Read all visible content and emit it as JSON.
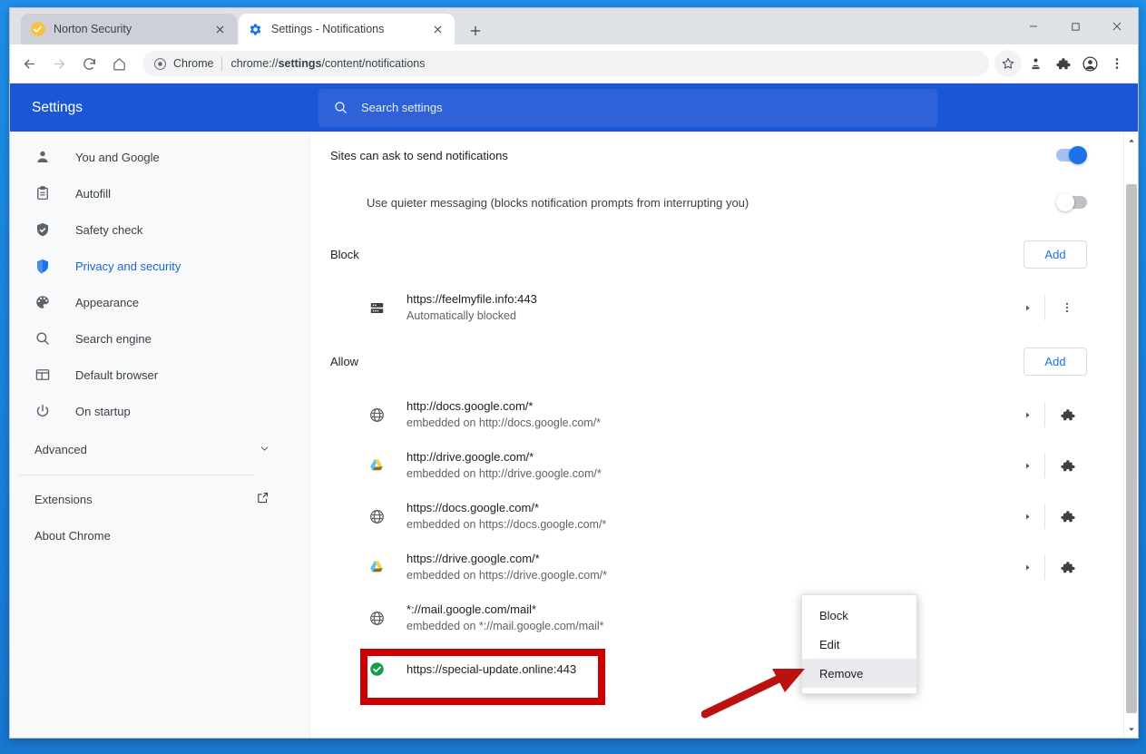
{
  "browser": {
    "tabs": [
      {
        "title": "Norton Security",
        "favicon": "norton-check-icon",
        "active": false
      },
      {
        "title": "Settings - Notifications",
        "favicon": "gear-icon",
        "active": true
      }
    ],
    "new_tab_label": "+",
    "window_controls": {
      "minimize": "—",
      "maximize": "☐",
      "close": "✕"
    },
    "omnibox": {
      "scheme_label": "Chrome",
      "url_prefix": "chrome://",
      "url_bold": "settings",
      "url_suffix": "/content/notifications",
      "full_url": "chrome://settings/content/notifications"
    },
    "toolbar_icons": [
      "back-icon",
      "forward-icon",
      "reload-icon",
      "home-icon",
      "bookmark-star-icon",
      "norton-extension-icon",
      "extensions-puzzle-icon",
      "profile-avatar-icon",
      "chrome-menu-icon"
    ]
  },
  "settings": {
    "title": "Settings",
    "search_placeholder": "Search settings",
    "sidebar": {
      "items": [
        {
          "label": "You and Google",
          "icon": "person-icon",
          "active": false
        },
        {
          "label": "Autofill",
          "icon": "clipboard-icon",
          "active": false
        },
        {
          "label": "Safety check",
          "icon": "shield-check-icon",
          "active": false
        },
        {
          "label": "Privacy and security",
          "icon": "shield-icon",
          "active": true
        },
        {
          "label": "Appearance",
          "icon": "palette-icon",
          "active": false
        },
        {
          "label": "Search engine",
          "icon": "search-icon",
          "active": false
        },
        {
          "label": "Default browser",
          "icon": "browser-window-icon",
          "active": false
        },
        {
          "label": "On startup",
          "icon": "power-icon",
          "active": false
        }
      ],
      "advanced_label": "Advanced",
      "extensions_label": "Extensions",
      "about_label": "About Chrome"
    },
    "main": {
      "primary_toggle": {
        "label": "Sites can ask to send notifications",
        "state": "on"
      },
      "quieter_toggle": {
        "label": "Use quieter messaging (blocks notification prompts from interrupting you)",
        "state": "off"
      },
      "block_section": {
        "title": "Block",
        "add_label": "Add",
        "rows": [
          {
            "url": "https://feelmyfile.info:443",
            "sub": "Automatically blocked",
            "icon": "server-rack-icon",
            "action": "overflow-menu-icon"
          }
        ]
      },
      "allow_section": {
        "title": "Allow",
        "add_label": "Add",
        "rows": [
          {
            "url": "http://docs.google.com/*",
            "sub": "embedded on http://docs.google.com/*",
            "icon": "globe-icon",
            "action": "extension-puzzle-icon"
          },
          {
            "url": "http://drive.google.com/*",
            "sub": "embedded on http://drive.google.com/*",
            "icon": "drive-favicon",
            "action": "extension-puzzle-icon"
          },
          {
            "url": "https://docs.google.com/*",
            "sub": "embedded on https://docs.google.com/*",
            "icon": "globe-icon",
            "action": "extension-puzzle-icon"
          },
          {
            "url": "https://drive.google.com/*",
            "sub": "embedded on https://drive.google.com/*",
            "icon": "drive-favicon",
            "action": "extension-puzzle-icon"
          },
          {
            "url": "*://mail.google.com/mail*",
            "sub": "embedded on *://mail.google.com/mail*",
            "icon": "globe-icon",
            "action": "extension-puzzle-icon"
          },
          {
            "url": "https://special-update.online:443",
            "sub": "",
            "icon": "green-check-icon",
            "action": "",
            "highlighted": true
          }
        ]
      }
    }
  },
  "context_menu": {
    "items": [
      {
        "label": "Block",
        "highlighted": false
      },
      {
        "label": "Edit",
        "highlighted": false
      },
      {
        "label": "Remove",
        "highlighted": true
      }
    ]
  },
  "annotations": {
    "highlight_color": "#cc0000",
    "arrow_color": "#bb1111",
    "accent_color": "#1a73e8",
    "header_color": "#1a56d6"
  }
}
